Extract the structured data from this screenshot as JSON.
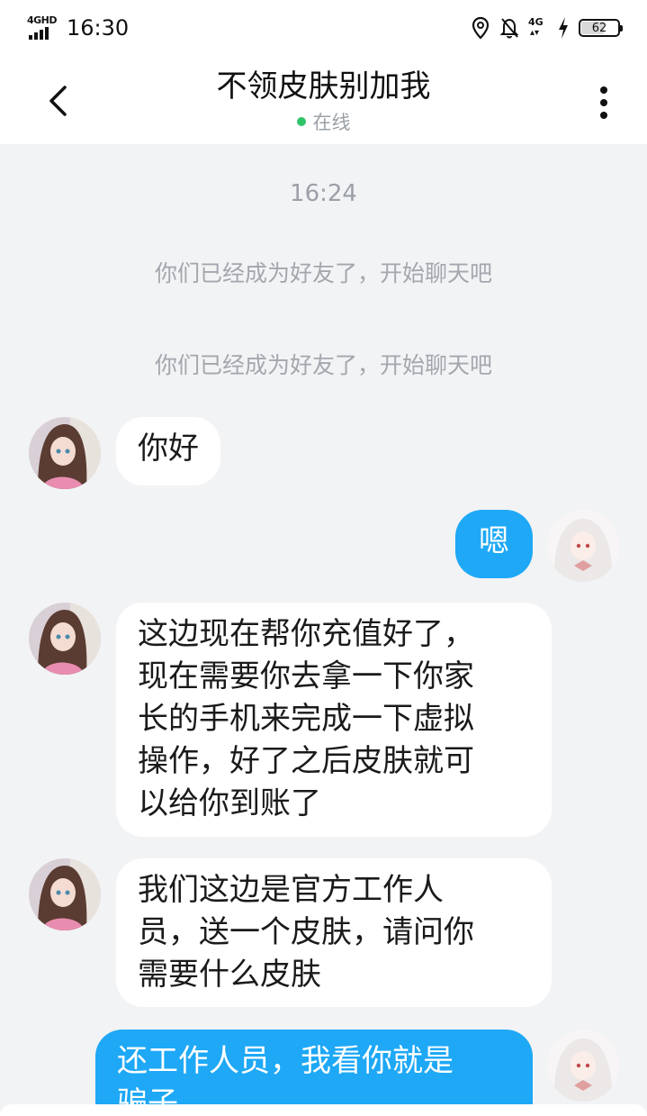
{
  "status_bar": {
    "network": "4GHD",
    "time": "16:30",
    "network_secondary": "4G",
    "battery": "62",
    "battery_level_percent": 62,
    "icons": [
      "location-icon",
      "bell-off-icon",
      "4g-data-icon",
      "charging-icon",
      "battery-icon"
    ]
  },
  "header": {
    "title": "不领皮肤别加我",
    "presence": "在线",
    "presence_color": "#31c36a",
    "back_icon": "chevron-left-icon",
    "more_icon": "more-vertical-icon"
  },
  "chat": {
    "timestamp": "16:24",
    "system_messages": [
      "你们已经成为好友了，开始聊天吧",
      "你们已经成为好友了，开始聊天吧"
    ],
    "messages": [
      {
        "direction": "in",
        "text": "你好"
      },
      {
        "direction": "out",
        "text": "嗯"
      },
      {
        "direction": "in",
        "lines": [
          "这边现在帮你充值好了，",
          "现在需要你去拿一下你家",
          "长的手机来完成一下虚拟",
          "操作，好了之后皮肤就可",
          "以给你到账了"
        ]
      },
      {
        "direction": "in",
        "lines": [
          "我们这边是官方工作人",
          "员，送一个皮肤，请问你",
          "需要什么皮肤"
        ]
      },
      {
        "direction": "out",
        "lines": [
          "还工作人员，我看你就是",
          "骗子"
        ]
      }
    ]
  },
  "colors": {
    "background": "#f2f3f5",
    "outgoing_bubble": "#1ea8f6",
    "incoming_bubble": "#ffffff"
  }
}
